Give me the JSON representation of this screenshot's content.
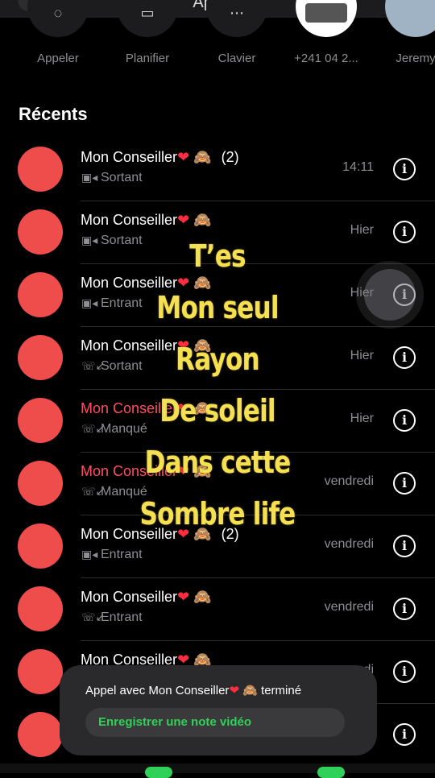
{
  "header": {
    "title": "Appels"
  },
  "quick_actions": [
    {
      "label": "Appeler",
      "icon": "phone-icon"
    },
    {
      "label": "Planifier",
      "icon": "calendar-icon"
    },
    {
      "label": "Clavier",
      "icon": "keypad-icon"
    },
    {
      "label": "+241 04 2...",
      "icon": "contact-photo"
    },
    {
      "label": "Jeremy",
      "icon": "contact-photo"
    }
  ],
  "recents": {
    "title": "Récents",
    "items": [
      {
        "name": "Mon Conseiller",
        "count": "(2)",
        "type": "Sortant",
        "time": "14:11",
        "missed": false,
        "kind": "video"
      },
      {
        "name": "Mon Conseiller",
        "count": "",
        "type": "Sortant",
        "time": "Hier",
        "missed": false,
        "kind": "video"
      },
      {
        "name": "Mon Conseiller",
        "count": "",
        "type": "Entrant",
        "time": "Hier",
        "missed": false,
        "kind": "video"
      },
      {
        "name": "Mon Conseiller",
        "count": "",
        "type": "Sortant",
        "time": "Hier",
        "missed": false,
        "kind": "phone"
      },
      {
        "name": "Mon Conseiller",
        "count": "",
        "type": "Manqué",
        "time": "Hier",
        "missed": true,
        "kind": "phone"
      },
      {
        "name": "Mon Conseiller",
        "count": "",
        "type": "Manqué",
        "time": "vendredi",
        "missed": true,
        "kind": "phone"
      },
      {
        "name": "Mon Conseiller",
        "count": "(2)",
        "type": "Entrant",
        "time": "vendredi",
        "missed": false,
        "kind": "video"
      },
      {
        "name": "Mon Conseiller",
        "count": "",
        "type": "Entrant",
        "time": "vendredi",
        "missed": false,
        "kind": "phone"
      },
      {
        "name": "Mon Conseiller",
        "count": "",
        "type": "",
        "time": "di",
        "missed": false,
        "kind": "phone"
      },
      {
        "name": "",
        "count": "",
        "type": "",
        "time": "",
        "missed": false,
        "kind": "phone"
      }
    ]
  },
  "overlay_lines": [
    "T’es",
    "Mon seul",
    "Rayon",
    "De soleil",
    "Dans cette",
    "Sombre life"
  ],
  "toast": {
    "prefix": "Appel avec Mon Conseiller",
    "suffix": "terminé",
    "button": "Enregistrer une note vidéo"
  },
  "emoji": {
    "heart": "❤",
    "monkey": "🙈"
  },
  "colors": {
    "accent": "#30d158",
    "avatar": "#ef4c4c",
    "missed": "#ff4d61",
    "overlay_text": "#f5df52"
  }
}
